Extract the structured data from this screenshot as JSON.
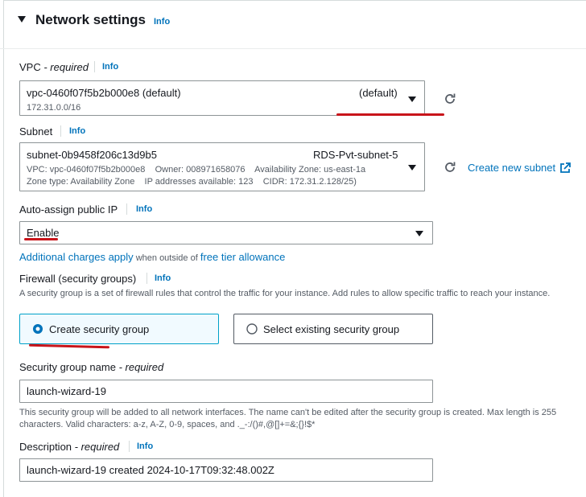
{
  "header": {
    "title": "Network settings",
    "info": "Info"
  },
  "vpc": {
    "label": "VPC",
    "required_suffix": " - required",
    "info": "Info",
    "value": "vpc-0460f07f5b2b000e8 (default)",
    "cidr": "172.31.0.0/16",
    "tag": "(default)"
  },
  "subnet": {
    "label": "Subnet",
    "info": "Info",
    "value": "subnet-0b9458f206c13d9b5",
    "name": "RDS-Pvt-subnet-5",
    "line1": "VPC: vpc-0460f07f5b2b000e8    Owner: 008971658076    Availability Zone: us-east-1a",
    "line2": "Zone type: Availability Zone    IP addresses available: 123    CIDR: 172.31.2.128/25)",
    "create_link": "Create new subnet"
  },
  "public_ip": {
    "label": "Auto-assign public IP",
    "info": "Info",
    "value": "Enable"
  },
  "charges": {
    "link1": "Additional charges apply",
    "middle": " when outside of ",
    "link2": "free tier allowance"
  },
  "firewall": {
    "label": "Firewall (security groups)",
    "info": "Info",
    "description": "A security group is a set of firewall rules that control the traffic for your instance. Add rules to allow specific traffic to reach your instance.",
    "option_create": "Create security group",
    "option_existing": "Select existing security group",
    "selected": "create"
  },
  "sg_name": {
    "label": "Security group name",
    "required_suffix": " - required",
    "value": "launch-wizard-19",
    "help": "This security group will be added to all network interfaces. The name can't be edited after the security group is created. Max length is 255 characters. Valid characters: a-z, A-Z, 0-9, spaces, and ._-:/()#,@[]+=&;{}!$*"
  },
  "description": {
    "label": "Description",
    "required_suffix": " - required",
    "info": "Info",
    "value": "launch-wizard-19 created 2024-10-17T09:32:48.002Z"
  },
  "colors": {
    "link": "#0073bb",
    "selected_border": "#00a1c9",
    "selected_bg": "#f1faff",
    "annotation": "#c8141a"
  }
}
